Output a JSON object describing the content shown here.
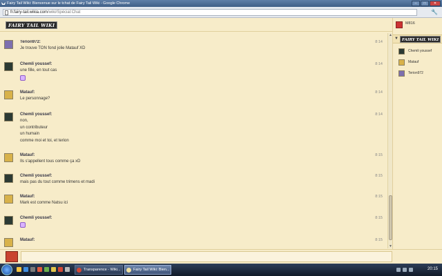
{
  "window": {
    "title": "Fairy Tail Wiki: Bienvenue sur le tchat de Fairy Tail Wiki - Google Chrome"
  },
  "address": {
    "host": "fr.fairy-tail.wikia.com",
    "path": "/wiki/Spécial:Chat"
  },
  "header": {
    "logo_text": "FAIRY TAIL WIKI"
  },
  "messages": [
    {
      "user": "Terion972:",
      "time": "8:14",
      "lines": [
        "Je trouve TON fond jolie Matauf XD"
      ],
      "avatar_color": "#7d6fae"
    },
    {
      "user": "Chemli youssef:",
      "time": "8:14",
      "lines": [
        "une fille, en tout cas"
      ],
      "emoji": true,
      "avatar_color": "#2c3a33"
    },
    {
      "user": "Matauf:",
      "time": "8:14",
      "lines": [
        "Le personnage?"
      ],
      "avatar_color": "#d8b24a"
    },
    {
      "user": "Chemli youssef:",
      "time": "8:14",
      "lines": [
        "non,",
        "un contributeur",
        "un humain",
        "comme moi et toi, et terion"
      ],
      "avatar_color": "#2c3a33"
    },
    {
      "user": "Matauf:",
      "time": "8:15",
      "lines": [
        "Ils s'appellent tous comme ça xD"
      ],
      "avatar_color": "#d8b24a"
    },
    {
      "user": "Chemli youssef:",
      "time": "8:15",
      "lines": [
        "mais pas du tout comme trimens et madi"
      ],
      "avatar_color": "#2c3a33"
    },
    {
      "user": "Matauf:",
      "time": "8:15",
      "lines": [
        "Mark est comme Natsu ici"
      ],
      "avatar_color": "#d8b24a"
    },
    {
      "user": "Chemli youssef:",
      "time": "8:15",
      "lines": [],
      "emoji": true,
      "avatar_color": "#2c3a33"
    },
    {
      "user": "Matauf:",
      "time": "8:15",
      "lines": [],
      "avatar_color": "#d8b24a"
    }
  ],
  "sidebar": {
    "me": "M816",
    "room_logo": "FAIRY TAIL WIKI",
    "users": [
      {
        "name": "Chemli youssef",
        "color": "#2c3a33"
      },
      {
        "name": "Matauf",
        "color": "#d8b24a"
      },
      {
        "name": "Terion972",
        "color": "#7d6fae"
      }
    ]
  },
  "taskbar": {
    "tasks": [
      "Transparence - Wiki...",
      "Fairy Tail Wiki: Bien..."
    ],
    "clock": "20:15"
  },
  "colors": {
    "background": "#f7ecc9",
    "name": "#334455"
  }
}
